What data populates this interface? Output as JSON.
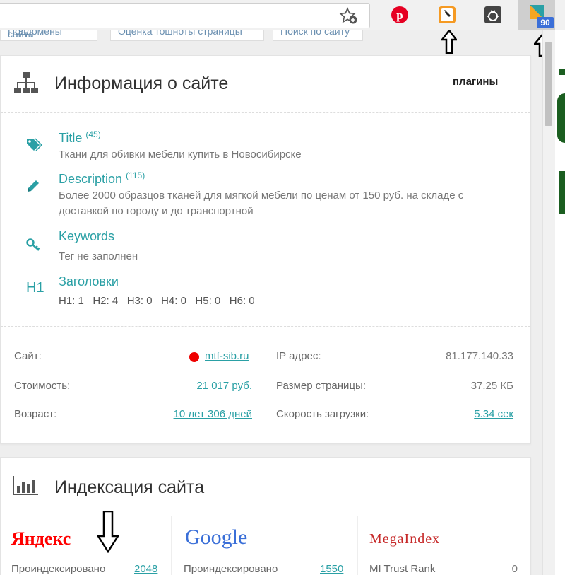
{
  "browser": {
    "extensions": [
      {
        "name": "pinterest"
      },
      {
        "name": "tag-extension"
      },
      {
        "name": "bug-extension"
      },
      {
        "name": "pr-cy-extension",
        "badge": "90"
      }
    ]
  },
  "subtabs": [
    "Поддомены сайта",
    "Оценка тошноты страницы",
    "Поиск по сайту"
  ],
  "site_info": {
    "title": "Информация о сайте",
    "plugins_label": "плагины",
    "items": [
      {
        "label": "Title",
        "count": "(45)",
        "value": "Ткани для обивки мебели купить в Новосибирске"
      },
      {
        "label": "Description",
        "count": "(115)",
        "value": "Более 2000 образцов тканей для мягкой мебели по ценам от 150 руб. на складе с доставкой по городу и до транспортной"
      },
      {
        "label": "Keywords",
        "count": "",
        "value": "Тег не заполнен"
      },
      {
        "label": "Заголовки",
        "count": "",
        "value": "H1: 1   H2: 4   H3: 0   H4: 0   H5: 0   H6: 0"
      }
    ],
    "h1_icon": "H1",
    "stats_left": [
      {
        "key": "Сайт:",
        "value": "mtf-sib.ru"
      },
      {
        "key": "Стоимость:",
        "value": "21 017 руб."
      },
      {
        "key": "Возраст:",
        "value": "10 лет 306 дней"
      }
    ],
    "stats_right": [
      {
        "key": "IP адрес:",
        "value": "81.177.140.33"
      },
      {
        "key": "Размер страницы:",
        "value": "37.25 КБ"
      },
      {
        "key": "Скорость загрузки:",
        "value": "5.34 сек"
      }
    ]
  },
  "indexing": {
    "title": "Индексация сайта",
    "engines": [
      {
        "logo": "Яндекс",
        "metric": "Проиндексировано",
        "value": "2048"
      },
      {
        "logo": "Google",
        "metric": "Проиндексировано",
        "value": "1550"
      },
      {
        "logo": "MegaIndex",
        "metric": "MI Trust Rank",
        "value": "0"
      }
    ]
  },
  "colors": {
    "accent": "#2aa0a5",
    "status_dot": "#ee0000"
  }
}
